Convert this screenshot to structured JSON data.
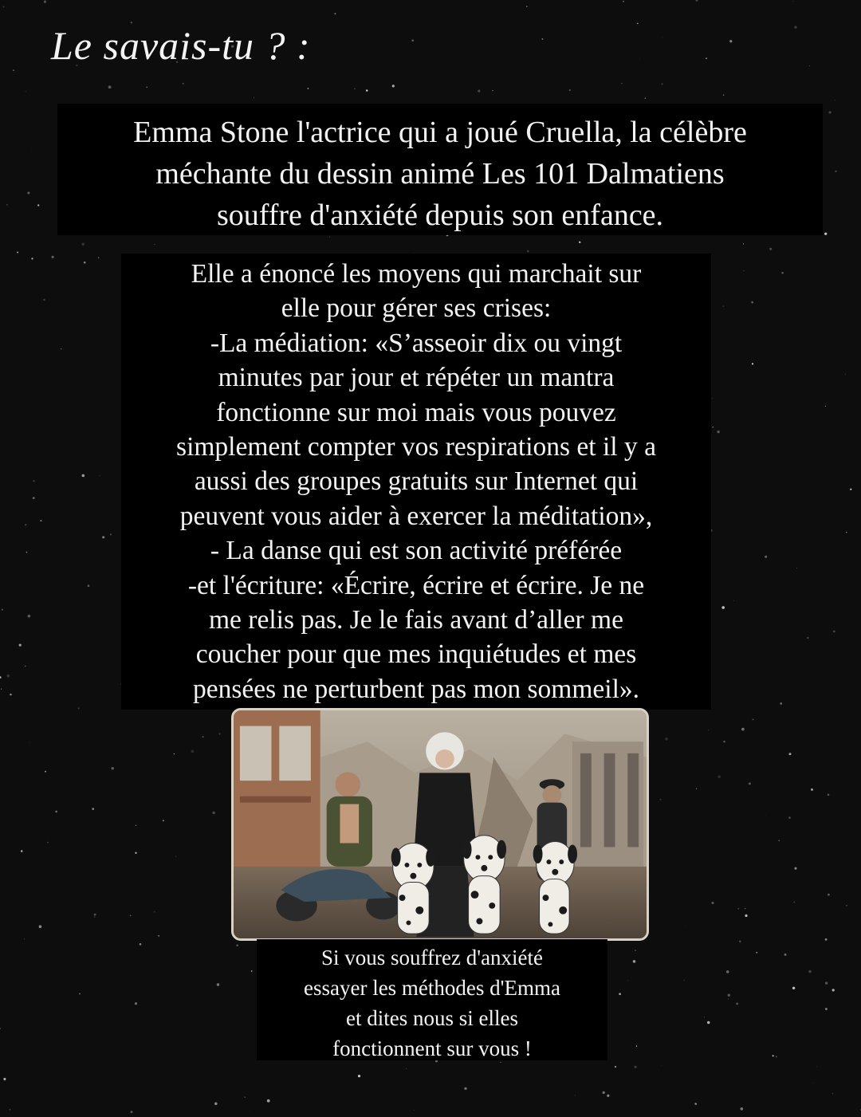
{
  "title": "Le savais-tu ? :",
  "intro_lines": [
    "Emma Stone l'actrice qui a joué Cruella, la célèbre",
    "méchante du dessin animé Les 101 Dalmatiens",
    "souffre d'anxiété depuis son enfance."
  ],
  "body_lines": [
    "Elle a énoncé les moyens qui marchait sur",
    "elle pour gérer ses crises:",
    "-La médiation:  «S’asseoir dix ou vingt",
    "minutes par jour et répéter un mantra",
    "fonctionne sur moi mais vous pouvez",
    "simplement compter vos respirations et il y a",
    "aussi des groupes gratuits sur Internet qui",
    "peuvent vous aider à exercer la méditation»,",
    "- La danse qui est son activité préférée",
    "-et l'écriture: «Écrire, écrire et écrire. Je ne",
    "me relis pas. Je le fais avant d’aller me",
    "coucher pour que mes inquiétudes et mes",
    "pensées ne perturbent pas mon sommeil»."
  ],
  "outro_lines": [
    "Si vous souffrez d'anxiété",
    "essayer les méthodes d'Emma",
    "et dites nous si elles",
    "fonctionnent sur vous !"
  ],
  "colors": {
    "background": "#0d0d0d",
    "text_block": "#000000",
    "text": "#f2f2f2"
  }
}
